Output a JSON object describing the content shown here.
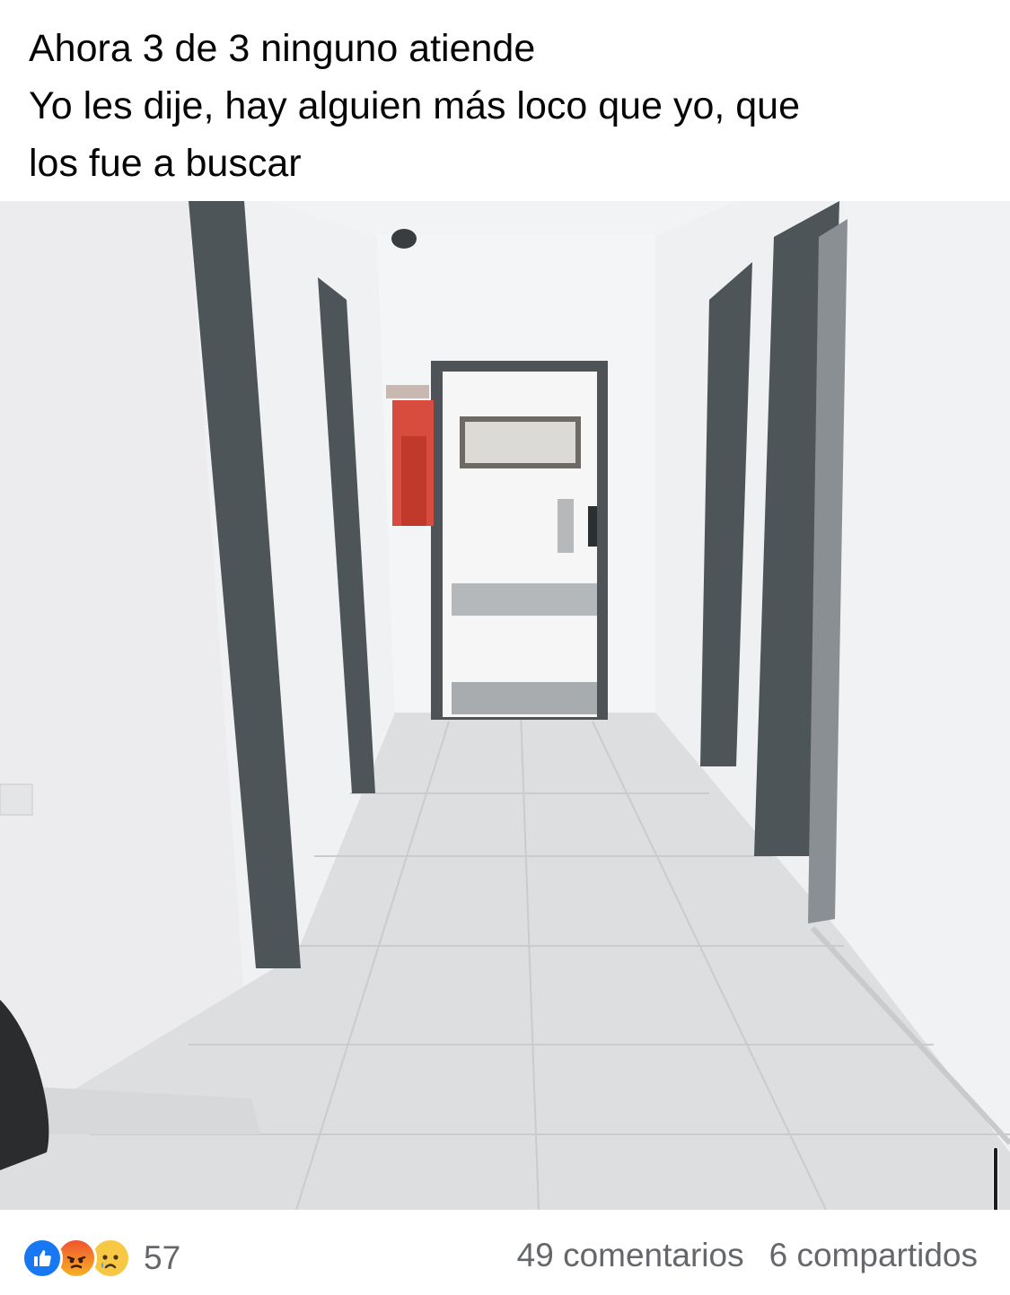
{
  "post": {
    "text_lines": [
      "Ahora 3 de 3 ninguno atiende",
      "Yo les dije, hay alguien más loco que yo, que",
      "los fue a buscar"
    ]
  },
  "photo": {
    "subject": "hospital-corridor-photo"
  },
  "footer": {
    "reaction_icons": [
      "like-icon",
      "angry-icon",
      "sad-icon"
    ],
    "reaction_count": "57",
    "comments": "49 comentarios",
    "shares": "6 compartidos"
  },
  "colors": {
    "like_blue": "#1877f2",
    "meta_gray": "#65676b",
    "text": "#050505"
  }
}
